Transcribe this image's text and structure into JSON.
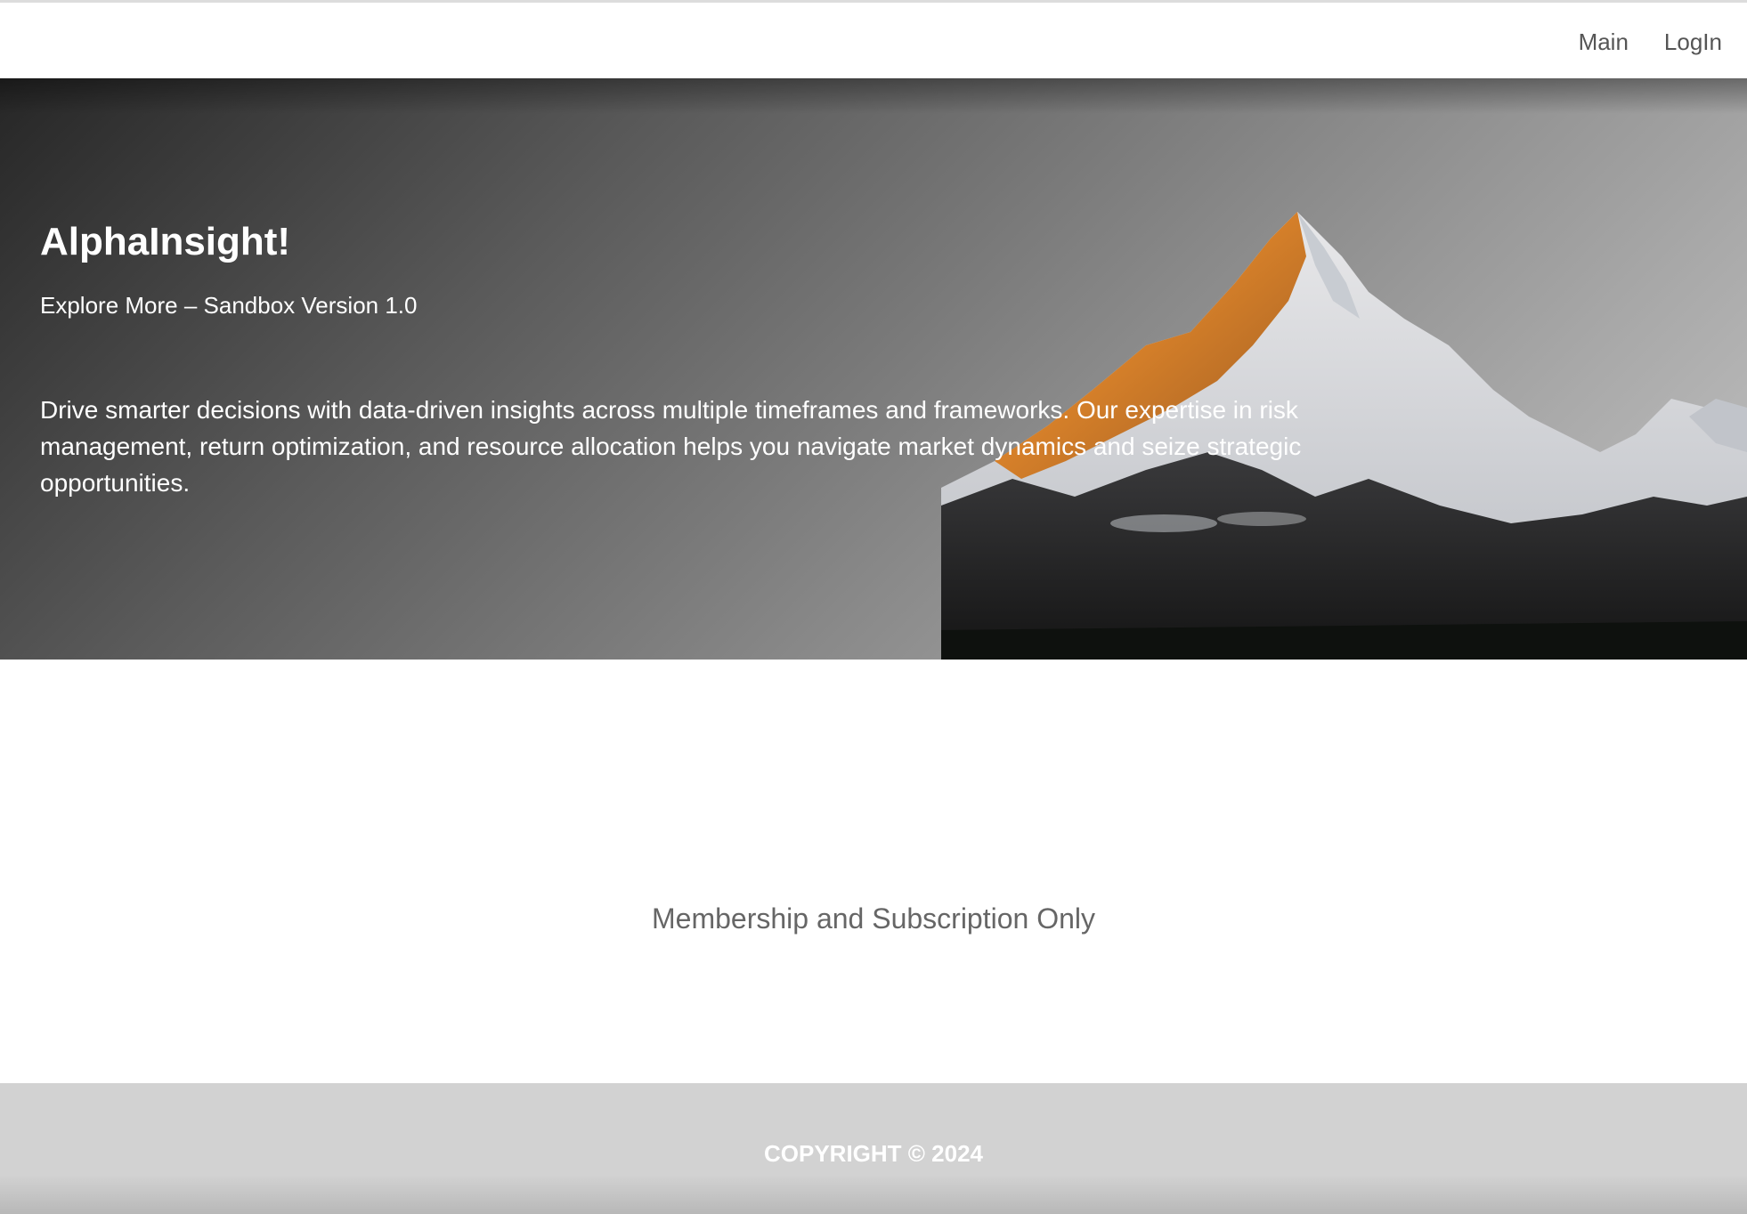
{
  "nav": {
    "items": [
      {
        "label": "Main"
      },
      {
        "label": "LogIn"
      }
    ]
  },
  "hero": {
    "title": "AlphaInsight!",
    "subtitle": "Explore More – Sandbox Version 1.0",
    "description": "Drive smarter decisions with data-driven insights across multiple timeframes and frameworks. Our expertise in risk management, return optimization, and resource allocation helps you navigate market dynamics and seize strategic opportunities.",
    "image": "snow-capped-mountain-sunset"
  },
  "membership": {
    "text": "Membership and Subscription Only"
  },
  "footer": {
    "copyright": "COPYRIGHT © 2024"
  },
  "colors": {
    "nav_text": "#555555",
    "hero_text": "#ffffff",
    "membership_text": "#666666",
    "footer_bg": "#d2d2d2"
  }
}
